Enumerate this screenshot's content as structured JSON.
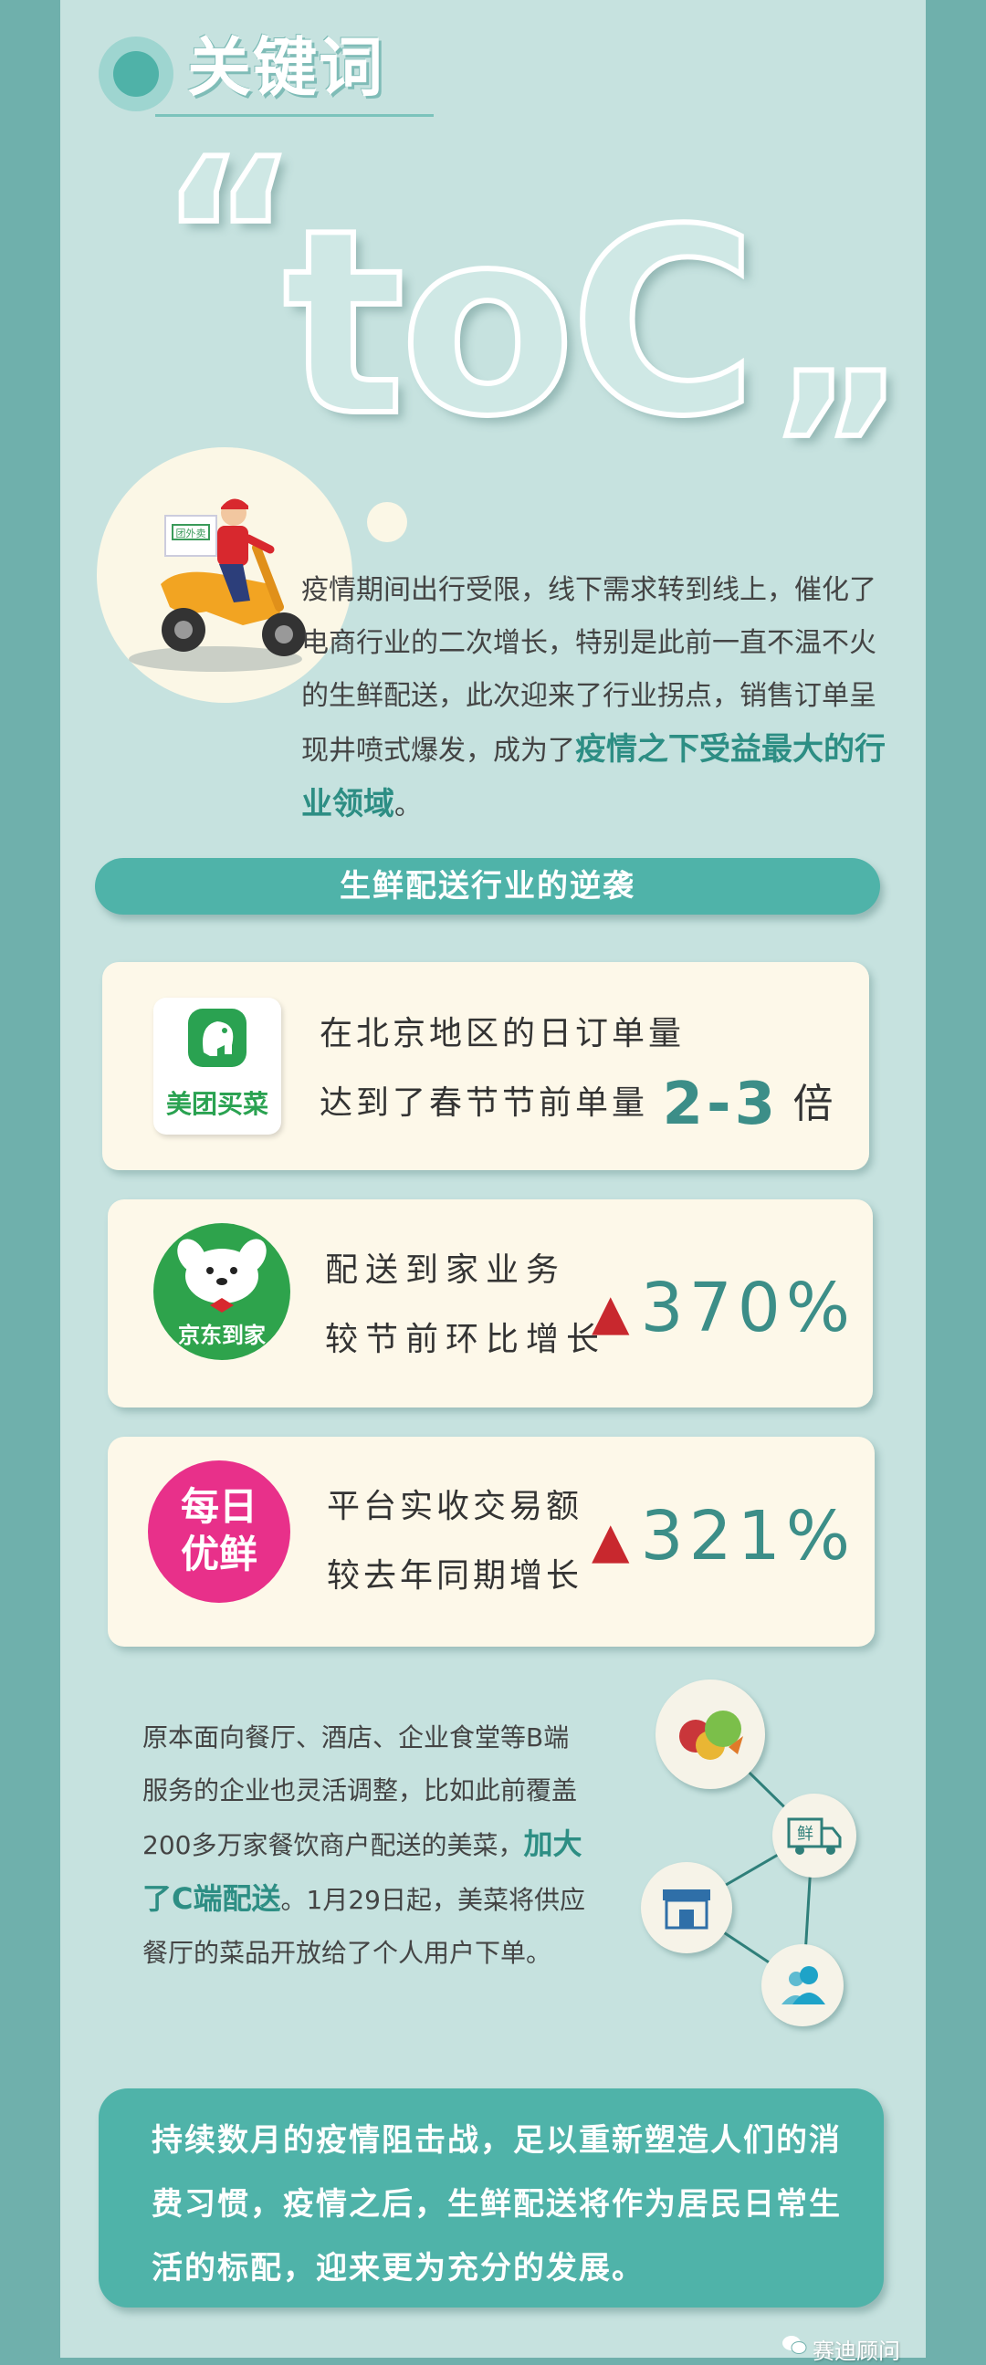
{
  "header": {
    "title": "关键词",
    "keyword": "toC",
    "quote_open": "“",
    "quote_close": "”"
  },
  "intro": {
    "text_part1": "疫情期间出行受限，线下需求转到线上，催化了电商行业的二次增长，特别是此前一直不温不火的生鲜配送，此次迎来了行业拐点，销售订单呈现井喷式爆发，成为了",
    "highlight": "疫情之下受益最大的行业领域",
    "text_part2": "。",
    "scooter_box_label": "团外卖"
  },
  "banner": {
    "title": "生鲜配送行业的逆袭"
  },
  "cards": [
    {
      "logo_label": "美团买菜",
      "line1": "在北京地区的日订单量",
      "line2": "达到了春节节前单量",
      "multiplier": "2-3",
      "unit": "倍"
    },
    {
      "logo_label": "京东到家",
      "line1": "配送到家业务",
      "line2": "较节前环比增长",
      "stat": "370%",
      "trend_icon": "up-triangle"
    },
    {
      "logo_label_line1": "每日",
      "logo_label_line2": "优鲜",
      "line1": "平台实收交易额",
      "line2": "较去年同期增长",
      "stat": "321%",
      "trend_icon": "up-triangle"
    }
  ],
  "lower": {
    "text_part1": "原本面向餐厅、酒店、企业食堂等B端服务的企业也灵活调整，比如此前覆盖200多万家餐饮商户配送的美菜，",
    "highlight": "加大了C端配送",
    "text_part2": "。1月29日起，美菜将供应餐厅的菜品开放给了个人用户下单。",
    "truck_label": "鲜",
    "icons": [
      "vegetables-icon",
      "delivery-truck-icon",
      "store-icon",
      "users-icon"
    ]
  },
  "conclusion": {
    "text": "持续数月的疫情阻击战，足以重新塑造人们的消费习惯，疫情之后，生鲜配送将作为居民日常生活的标配，迎来更为充分的发展。"
  },
  "watermark": {
    "text": "赛迪顾问"
  },
  "colors": {
    "background": "#6fb0ac",
    "panel": "#c6e2df",
    "accent": "#4fb3a9",
    "highlight_text": "#2d8e84",
    "card": "#fdf8e9",
    "up_arrow": "#c8282e"
  }
}
